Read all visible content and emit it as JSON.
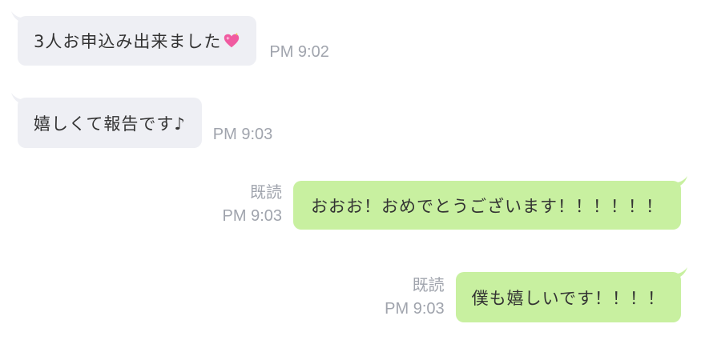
{
  "messages": [
    {
      "side": "in",
      "text": "3人お申込み出来ました",
      "emoji": "sparkling-heart",
      "time": "PM 9:02",
      "read": ""
    },
    {
      "side": "in",
      "text": "嬉しくて報告です♪",
      "time": "PM 9:03",
      "read": ""
    },
    {
      "side": "out",
      "text": "おおお！おめでとうございます！！！！！！",
      "time": "PM 9:03",
      "read": "既読"
    },
    {
      "side": "out",
      "text": "僕も嬉しいです！！！！",
      "time": "PM 9:03",
      "read": "既読"
    }
  ],
  "colors": {
    "incoming_bubble": "#eeeff4",
    "outgoing_bubble": "#c8f0a0",
    "meta_text": "#a0a4ad",
    "message_text": "#333333"
  }
}
